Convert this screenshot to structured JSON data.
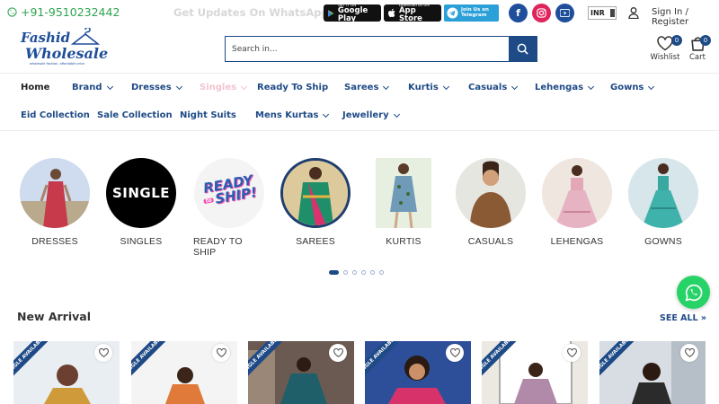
{
  "topbar": {
    "phone": "+91-9510232442",
    "whatsapp_updates": "Get Updates On WhatsApp",
    "google_play": {
      "small": "GET IT ON",
      "big": "Google Play"
    },
    "app_store": {
      "small": "Download on the",
      "big": "App Store"
    },
    "telegram": {
      "line1": "Join Us on",
      "line2": "Telegram"
    },
    "currency": "INR",
    "signin": "Sign In / Register"
  },
  "header": {
    "logo_line1": "Fashid",
    "logo_line2": "Wholesale",
    "logo_tagline": "wholesale fashion, affordable price",
    "search_placeholder": "Search in...",
    "wishlist_label": "Wishlist",
    "wishlist_count": "0",
    "cart_label": "Cart",
    "cart_count": "0"
  },
  "nav": {
    "row1": [
      "Home",
      "Brand",
      "Dresses",
      "Singles",
      "Ready To Ship",
      "Sarees",
      "Kurtis",
      "Casuals",
      "Lehengas",
      "Gowns"
    ],
    "row2": [
      "Eid Collection",
      "Sale Collection",
      "Night Suits",
      "Mens Kurtas",
      "Jewellery"
    ]
  },
  "categories": [
    {
      "label": "DRESSES"
    },
    {
      "label": "SINGLES",
      "badge": "SINGLE"
    },
    {
      "label": "READY TO SHIP",
      "badge_line1": "READY",
      "badge_line2": "to",
      "badge_line3": "SHIP!"
    },
    {
      "label": "SAREES"
    },
    {
      "label": "KURTIS"
    },
    {
      "label": "CASUALS"
    },
    {
      "label": "LEHENGAS"
    },
    {
      "label": "GOWNS"
    }
  ],
  "carousel": {
    "pages": 6,
    "active": 1
  },
  "new_arrival": {
    "title": "New Arrival",
    "see_all": "SEE ALL",
    "ribbon": "SINGLE AVAILABLE"
  },
  "colors": {
    "brand": "#1e4a86",
    "green": "#2ea44f",
    "whatsapp": "#25d366"
  }
}
